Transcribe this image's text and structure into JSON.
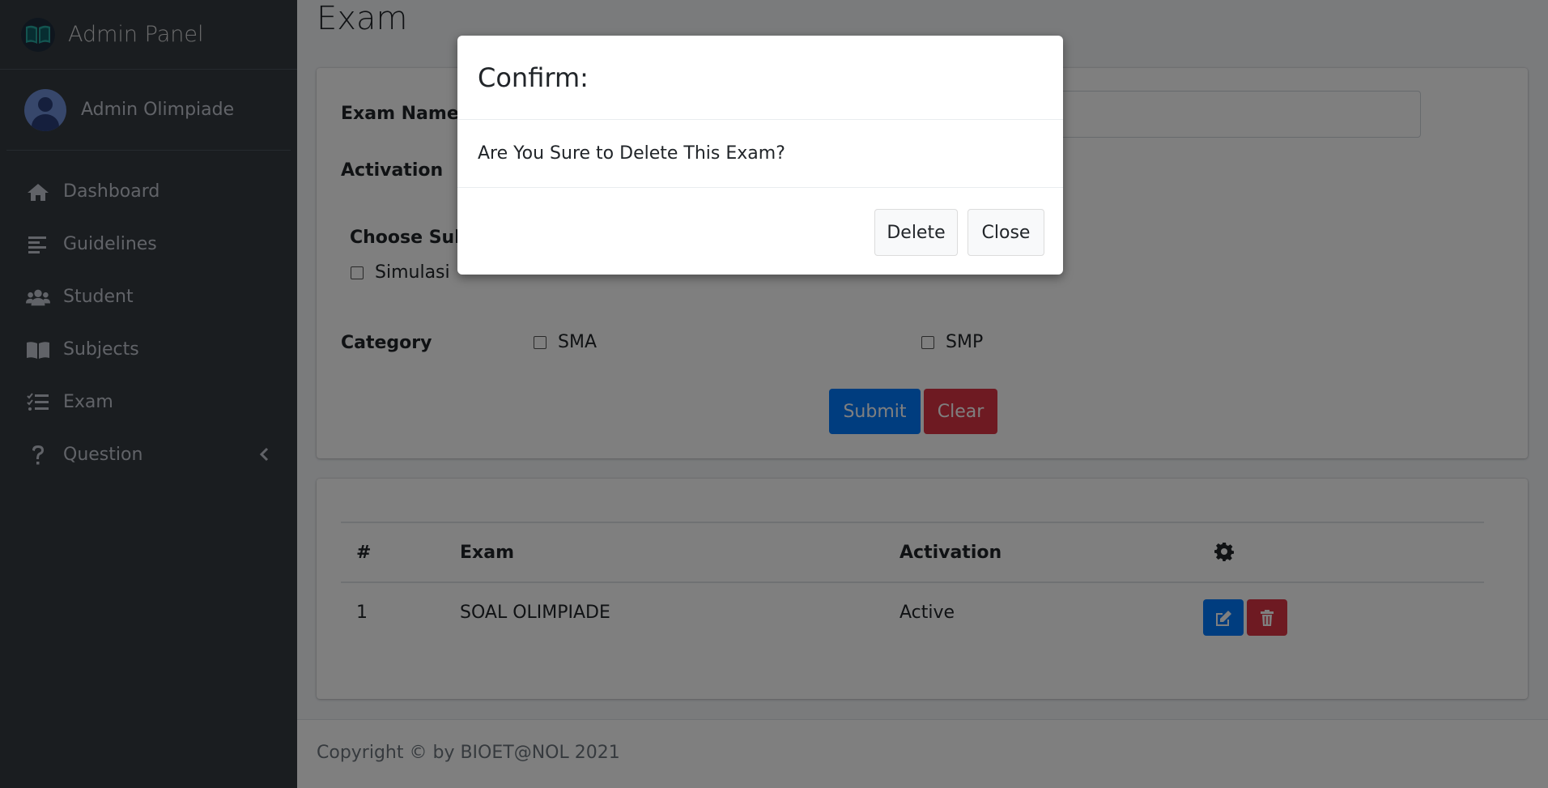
{
  "sidebar": {
    "brand": "Admin Panel",
    "user": "Admin Olimpiade",
    "items": [
      {
        "label": "Dashboard",
        "icon": "home-icon"
      },
      {
        "label": "Guidelines",
        "icon": "align-left-icon"
      },
      {
        "label": "Student",
        "icon": "users-icon"
      },
      {
        "label": "Subjects",
        "icon": "book-icon"
      },
      {
        "label": "Exam",
        "icon": "tasks-icon"
      },
      {
        "label": "Question",
        "icon": "question-icon"
      }
    ]
  },
  "page": {
    "title": "Exam"
  },
  "form": {
    "exam_name_label": "Exam Name",
    "exam_name_value": "",
    "activation_label": "Activation",
    "choose_subject_label": "Choose Subject",
    "subjects": [
      "Simulasi"
    ],
    "category_label": "Category",
    "categories": [
      "SMA",
      "SMP"
    ],
    "submit_label": "Submit",
    "clear_label": "Clear"
  },
  "table": {
    "headers": [
      "#",
      "Exam",
      "Activation"
    ],
    "settings_icon": "gear-icon",
    "rows": [
      {
        "no": "1",
        "exam": "SOAL OLIMPIADE",
        "activation": "Active"
      }
    ]
  },
  "footer": {
    "text": "Copyright © by BIOET@NOL 2021"
  },
  "modal": {
    "title": "Confirm:",
    "message": "Are You Sure to Delete This Exam?",
    "delete_label": "Delete",
    "close_label": "Close"
  },
  "colors": {
    "sidebar_bg": "#343a40",
    "primary": "#007bff",
    "danger": "#dc3545"
  }
}
